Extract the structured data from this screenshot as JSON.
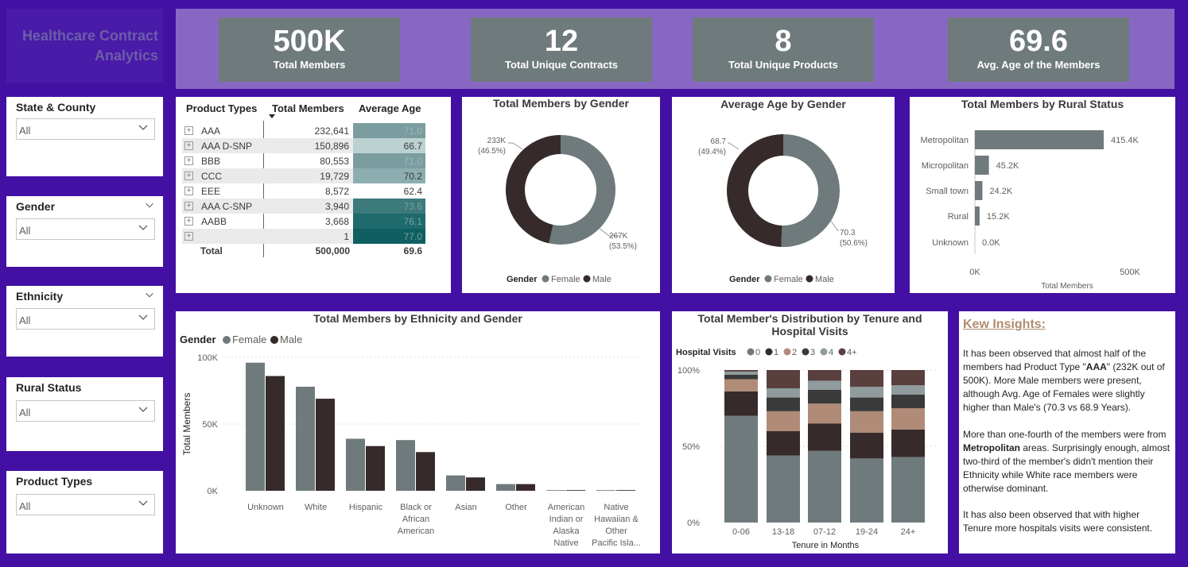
{
  "app_title": "Healthcare Contract Analytics",
  "kpis": [
    {
      "value": "500K",
      "label": "Total Members"
    },
    {
      "value": "12",
      "label": "Total Unique Contracts"
    },
    {
      "value": "8",
      "label": "Total Unique Products"
    },
    {
      "value": "69.6",
      "label": "Avg. Age of the Members"
    }
  ],
  "slicers": [
    {
      "title": "State & County",
      "value": "All"
    },
    {
      "title": "Gender",
      "value": "All"
    },
    {
      "title": "Ethnicity",
      "value": "All"
    },
    {
      "title": "Rural Status",
      "value": "All"
    },
    {
      "title": "Product Types",
      "value": "All"
    }
  ],
  "colors": {
    "female": "#6f7a7c",
    "male": "#362a2a",
    "accent": "#8867c4",
    "background": "#4310a3"
  },
  "product_table": {
    "headers": [
      "Product Types",
      "Total Members",
      "Average Age"
    ],
    "rows": [
      {
        "product": "AAA",
        "members": "232,641",
        "age": "71.0",
        "color": "#7b9d9f"
      },
      {
        "product": "AAA D-SNP",
        "members": "150,896",
        "age": "66.7",
        "color": "#bcd2d2"
      },
      {
        "product": "BBB",
        "members": "80,553",
        "age": "71.0",
        "color": "#7b9d9f"
      },
      {
        "product": "CCC",
        "members": "19,729",
        "age": "70.2",
        "color": "#8daeb0"
      },
      {
        "product": "EEE",
        "members": "8,572",
        "age": "62.4",
        "color": "#ffffff"
      },
      {
        "product": "AAA C-SNP",
        "members": "3,940",
        "age": "73.6",
        "color": "#3c7a7c"
      },
      {
        "product": "AABB",
        "members": "3,668",
        "age": "76.1",
        "color": "#1e6a6c"
      },
      {
        "product": "",
        "members": "1",
        "age": "77.0",
        "color": "#0f5f62"
      }
    ],
    "total": {
      "label": "Total",
      "members": "500,000",
      "age": "69.6"
    }
  },
  "chart_data": [
    {
      "type": "pie",
      "title": "Total Members by Gender",
      "legend_title": "Gender",
      "labels": [
        "Female",
        "Male"
      ],
      "values": [
        267,
        233
      ],
      "data_labels": [
        [
          "267K",
          "(53.5%)"
        ],
        [
          "233K",
          "(46.5%)"
        ]
      ],
      "legend_position": "bottom"
    },
    {
      "type": "pie",
      "title": "Average Age by Gender",
      "legend_title": "Gender",
      "labels": [
        "Female",
        "Male"
      ],
      "values": [
        70.3,
        68.7
      ],
      "data_labels": [
        [
          "70.3",
          "(50.6%)"
        ],
        [
          "68.7",
          "(49.4%)"
        ]
      ],
      "legend_position": "bottom"
    },
    {
      "type": "bar",
      "title": "Total Members by Rural Status",
      "orientation": "horizontal",
      "categories": [
        "Metropolitan",
        "Micropolitan",
        "Small town",
        "Rural",
        "Unknown"
      ],
      "values": [
        415.4,
        45.2,
        24.2,
        15.2,
        0.0
      ],
      "value_labels": [
        "415.4K",
        "45.2K",
        "24.2K",
        "15.2K",
        "0.0K"
      ],
      "xlabel": "Total Members",
      "xticks": [
        "0K",
        "500K"
      ],
      "xlim": [
        0,
        500
      ]
    },
    {
      "type": "bar",
      "title": "Total Members by Ethnicity and Gender",
      "legend_title": "Gender",
      "categories": [
        [
          "Unknown"
        ],
        [
          "White"
        ],
        [
          "Hispanic"
        ],
        [
          "Black or",
          "African",
          "American"
        ],
        [
          "Asian"
        ],
        [
          "Other"
        ],
        [
          "American",
          "Indian or",
          "Alaska",
          "Native"
        ],
        [
          "Native",
          "Hawaiian &",
          "Other",
          "Pacific Isla..."
        ]
      ],
      "series": [
        {
          "name": "Female",
          "values": [
            96,
            78,
            39,
            38,
            11.5,
            5,
            0.5,
            0.5
          ]
        },
        {
          "name": "Male",
          "values": [
            86,
            69,
            33.5,
            29,
            10,
            5,
            0.5,
            0.5
          ]
        }
      ],
      "ylabel": "Total Members",
      "yticks": [
        "100K",
        "50K",
        "0K"
      ],
      "ylim": [
        0,
        100
      ],
      "legend_position": "top-left"
    },
    {
      "type": "bar",
      "stacked": "percent",
      "title": "Total Member's Distribution by Tenure and Hospital Visits",
      "legend_title": "Hospital Visits",
      "categories": [
        "0-06",
        "13-18",
        "07-12",
        "19-24",
        "24+"
      ],
      "series": [
        {
          "name": "0",
          "values": [
            70,
            44,
            47,
            42,
            43
          ]
        },
        {
          "name": "1",
          "values": [
            16,
            16,
            18,
            17,
            18
          ]
        },
        {
          "name": "2",
          "values": [
            8,
            13,
            13,
            14,
            14
          ]
        },
        {
          "name": "3",
          "values": [
            3,
            9,
            9,
            9,
            9
          ]
        },
        {
          "name": "4",
          "values": [
            2,
            6,
            6,
            7,
            6
          ]
        },
        {
          "name": "4+",
          "values": [
            1,
            12,
            7,
            11,
            10
          ]
        }
      ],
      "series_colors": [
        "#6f7a7c",
        "#362a2a",
        "#b08b78",
        "#3a3a3a",
        "#8f9b9d",
        "#5a3f3f"
      ],
      "xlabel": "Tenure in Months",
      "yticks": [
        "100%",
        "50%",
        "0%"
      ],
      "ylim": [
        0,
        100
      ],
      "legend_position": "top-left"
    }
  ],
  "insights": {
    "heading": "Kew Insights:",
    "p1": [
      "It has been observed that almost half of the members had Product Type \"",
      "AAA",
      "\" (232K out of 500K). More Male members were present, although Avg. Age of Females were slightly higher than Male's (70.3 vs 68.9 Years)."
    ],
    "p2": [
      "More than one-fourth of the members were from ",
      "Metropolitan",
      " areas. Surprisingly enough, almost two-third of the member's didn't mention their Ethnicity while White race members were otherwise dominant."
    ],
    "p3": "It has also been observed that with higher Tenure more hospitals visits were consistent."
  }
}
